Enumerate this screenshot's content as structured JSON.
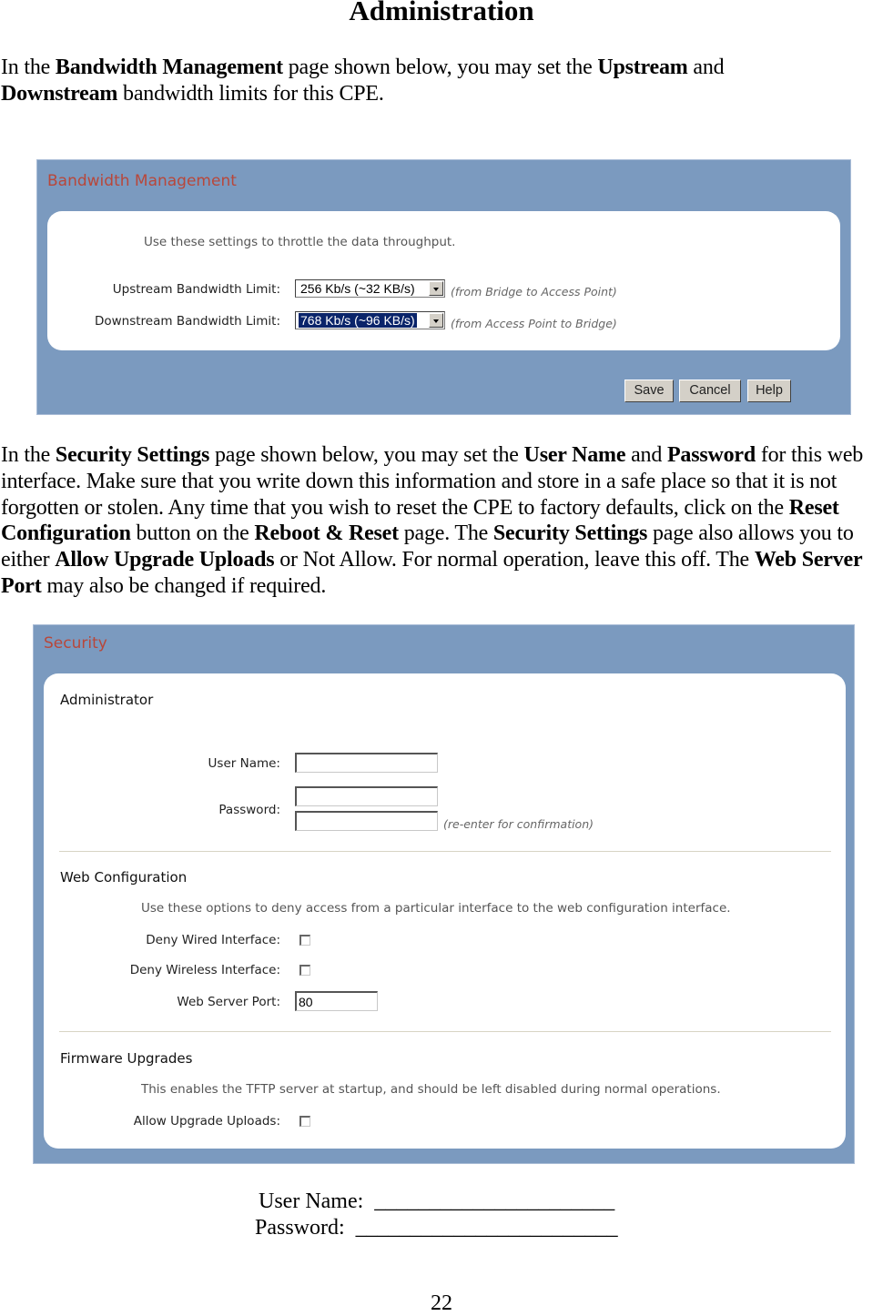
{
  "document": {
    "title": "Administration",
    "para1": {
      "t1": "In the ",
      "b1": "Bandwidth Management",
      "t2": " page shown below, you may set the ",
      "b2": "Upstream",
      "t3": " and ",
      "b3": "Downstream",
      "t4": " bandwidth limits for this CPE."
    },
    "para2": {
      "t1": "In the ",
      "b1": "Security Settings",
      "t2": " page shown below, you may set the ",
      "b2": "User Name",
      "t3": " and ",
      "b3": "Password",
      "t4": " for this web interface.  Make sure that you write down this information and store in a safe place so that it is not forgotten or stolen.  Any time that you wish to reset the CPE to factory defaults, click on the ",
      "b4": "Reset Configuration",
      "t5": " button on the ",
      "b5": "Reboot & Reset",
      "t6": " page. The ",
      "b6": "Security Settings",
      "t7": " page also allows you to either ",
      "b7": "Allow Upgrade Uploads",
      "t8": " or Not Allow.  For normal operation, leave this off.  The ",
      "b8": "Web Server Port",
      "t9": " may also be changed if required."
    },
    "form_lines": {
      "user_name_label": "User Name:",
      "user_name_blank": "______________________",
      "password_label": "Password:",
      "password_blank": "________________________"
    },
    "page_number": "22"
  },
  "bandwidth_panel": {
    "title": "Bandwidth Management",
    "description": "Use these settings to throttle the data throughput.",
    "upstream": {
      "label": "Upstream Bandwidth Limit:",
      "value": "256 Kb/s (~32 KB/s)",
      "note": "(from Bridge to Access Point)"
    },
    "downstream": {
      "label": "Downstream Bandwidth Limit:",
      "value": "768 Kb/s (~96 KB/s)",
      "note": "(from Access Point to Bridge)"
    },
    "buttons": {
      "save": "Save",
      "cancel": "Cancel",
      "help": "Help"
    }
  },
  "security_panel": {
    "title": "Security",
    "administrator": {
      "heading": "Administrator",
      "user_name_label": "User Name:",
      "user_name_value": "",
      "password_label": "Password:",
      "password_value": "",
      "password_confirm_value": "",
      "confirm_note": "(re-enter for confirmation)"
    },
    "web_configuration": {
      "heading": "Web Configuration",
      "description": "Use these options to deny access from a particular interface to the web configuration interface.",
      "deny_wired_label": "Deny Wired Interface:",
      "deny_wired_checked": false,
      "deny_wireless_label": "Deny Wireless Interface:",
      "deny_wireless_checked": false,
      "web_server_port_label": "Web Server Port:",
      "web_server_port_value": "80"
    },
    "firmware_upgrades": {
      "heading": "Firmware Upgrades",
      "description": "This enables the TFTP server at startup, and should be left disabled during normal operations.",
      "allow_upgrade_label": "Allow Upgrade Uploads:",
      "allow_upgrade_checked": false
    }
  },
  "colors": {
    "panel_bg": "#7b9abf",
    "panel_title": "#b8473a",
    "selection_bg": "#0a246a",
    "button_face": "#d4d0c8"
  }
}
